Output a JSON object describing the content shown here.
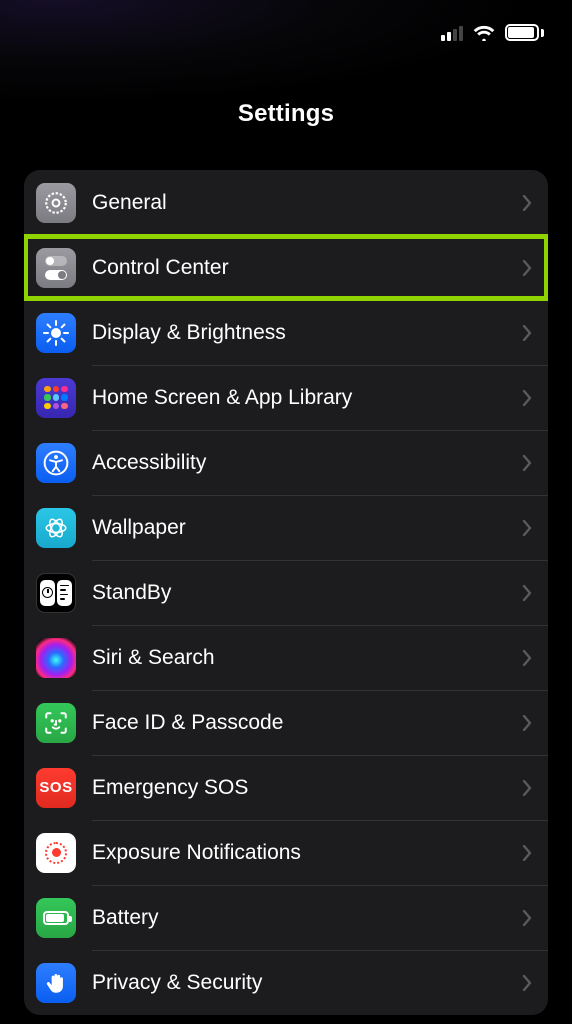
{
  "status": {
    "signal_bars_active": 2,
    "signal_bars_total": 4
  },
  "header": {
    "title": "Settings"
  },
  "rows": [
    {
      "label": "General",
      "icon": "gear-icon"
    },
    {
      "label": "Control Center",
      "icon": "toggles-icon",
      "highlighted": true
    },
    {
      "label": "Display & Brightness",
      "icon": "sun-icon"
    },
    {
      "label": "Home Screen & App Library",
      "icon": "app-grid-icon"
    },
    {
      "label": "Accessibility",
      "icon": "accessibility-icon"
    },
    {
      "label": "Wallpaper",
      "icon": "rosette-icon"
    },
    {
      "label": "StandBy",
      "icon": "standby-icon"
    },
    {
      "label": "Siri & Search",
      "icon": "siri-icon"
    },
    {
      "label": "Face ID & Passcode",
      "icon": "faceid-icon"
    },
    {
      "label": "Emergency SOS",
      "icon": "sos-icon"
    },
    {
      "label": "Exposure Notifications",
      "icon": "exposure-icon"
    },
    {
      "label": "Battery",
      "icon": "battery-icon"
    },
    {
      "label": "Privacy & Security",
      "icon": "hand-icon"
    }
  ],
  "highlight_color": "#8fd400"
}
